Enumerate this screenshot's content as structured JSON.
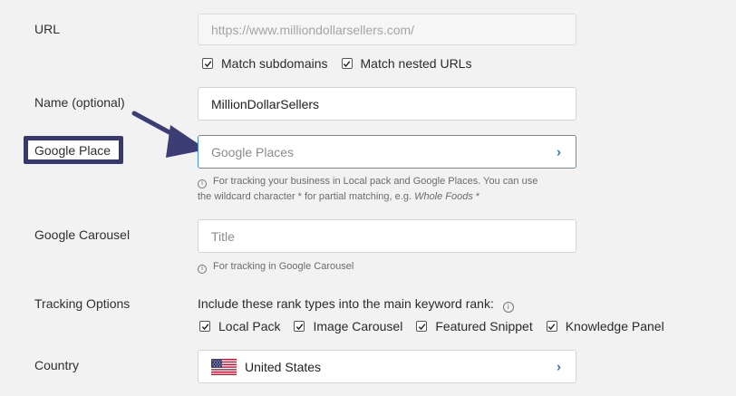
{
  "form": {
    "url": {
      "label": "URL",
      "placeholder": "https://www.milliondollarsellers.com/"
    },
    "url_options": [
      {
        "label": "Match subdomains",
        "checked": true
      },
      {
        "label": "Match nested URLs",
        "checked": true
      }
    ],
    "name": {
      "label": "Name (optional)",
      "value": "MillionDollarSellers"
    },
    "google_place": {
      "label": "Google Place",
      "placeholder": "Google Places",
      "hint_line1": "For tracking your business in Local pack and Google Places. You can use",
      "hint_line2_prefix": "the wildcard character * for partial matching, e.g. ",
      "hint_example": "Whole Foods",
      "hint_suffix": " *"
    },
    "google_carousel": {
      "label": "Google Carousel",
      "placeholder": "Title",
      "hint": "For tracking in Google Carousel"
    },
    "tracking_options": {
      "label": "Tracking Options",
      "description": "Include these rank types into the main keyword rank:",
      "options": [
        {
          "label": "Local Pack",
          "checked": true
        },
        {
          "label": "Image Carousel",
          "checked": true
        },
        {
          "label": "Featured Snippet",
          "checked": true
        },
        {
          "label": "Knowledge Panel",
          "checked": true
        }
      ]
    },
    "country": {
      "label": "Country",
      "value": "United States"
    }
  },
  "icons": {
    "checkmark": "✓",
    "chevron": "›",
    "info": "i"
  },
  "colors": {
    "accent": "#2f6fd1",
    "highlight": "#38396a",
    "arrow": "#3c3d75"
  }
}
